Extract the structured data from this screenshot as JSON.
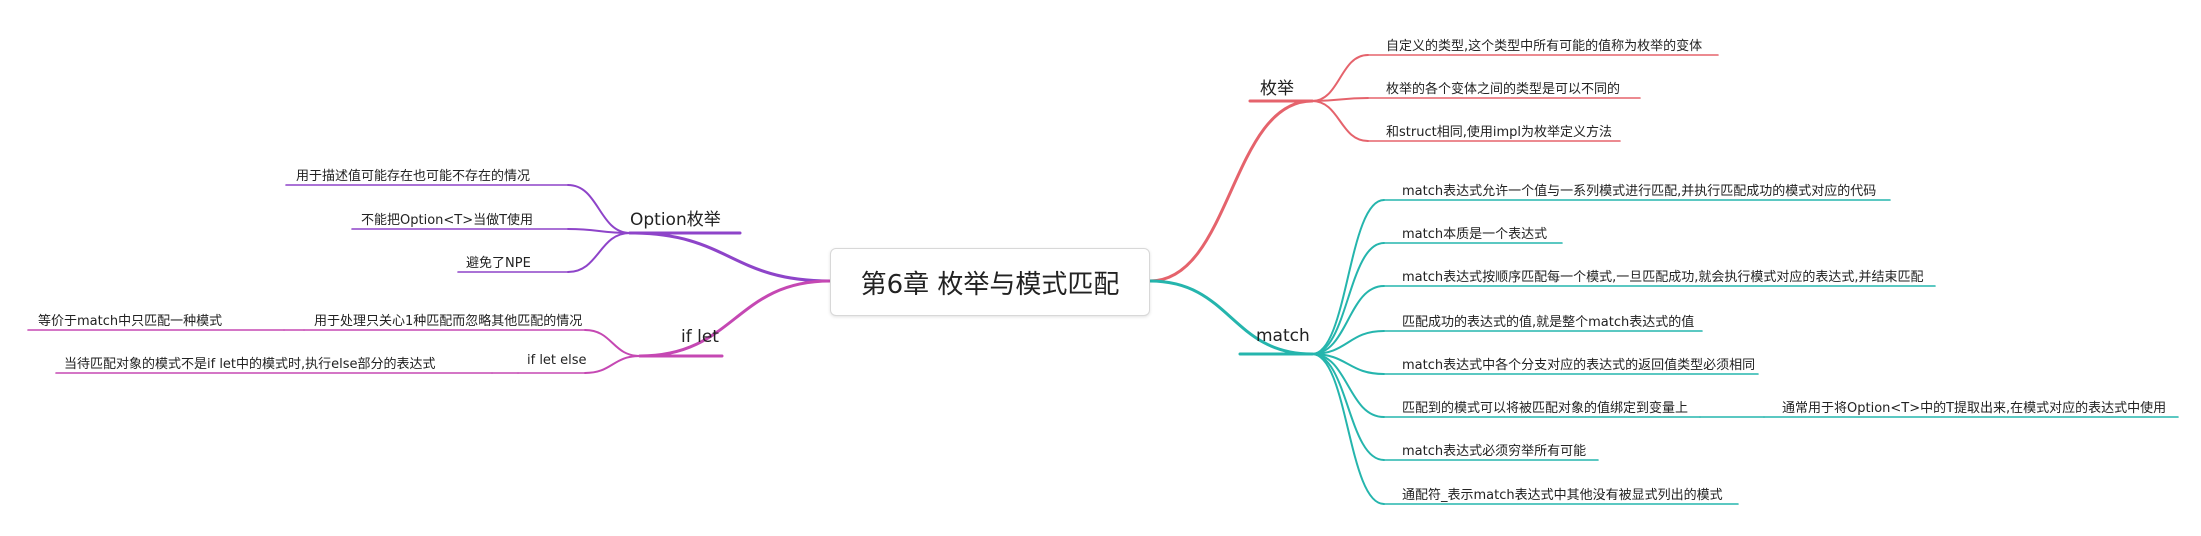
{
  "central": {
    "title": "第6章 枚举与模式匹配"
  },
  "colors": {
    "enum": "#e5636c",
    "match": "#25b5ad",
    "option": "#8e44c9",
    "iflet": "#c548b3"
  },
  "branches": {
    "enum": {
      "label": "枚举",
      "items": [
        "自定义的类型,这个类型中所有可能的值称为枚举的变体",
        "枚举的各个变体之间的类型是可以不同的",
        "和struct相同,使用impl为枚举定义方法"
      ]
    },
    "match": {
      "label": "match",
      "items": [
        "match表达式允许一个值与一系列模式进行匹配,并执行匹配成功的模式对应的代码",
        "match本质是一个表达式",
        "match表达式按顺序匹配每一个模式,一旦匹配成功,就会执行模式对应的表达式,并结束匹配",
        "匹配成功的表达式的值,就是整个match表达式的值",
        "match表达式中各个分支对应的表达式的返回值类型必须相同",
        "匹配到的模式可以将被匹配对象的值绑定到变量上",
        "match表达式必须穷举所有可能",
        "通配符_表示match表达式中其他没有被显式列出的模式"
      ],
      "sub": "通常用于将Option<T>中的T提取出来,在模式对应的表达式中使用"
    },
    "option": {
      "label": "Option枚举",
      "items": [
        "用于描述值可能存在也可能不存在的情况",
        "不能把Option<T>当做T使用",
        "避免了NPE"
      ]
    },
    "iflet": {
      "label": "if let",
      "items": [
        "用于处理只关心1种匹配而忽略其他匹配的情况",
        "if let else"
      ],
      "sub1": "等价于match中只匹配一种模式",
      "sub2": "当待匹配对象的模式不是if let中的模式时,执行else部分的表达式"
    }
  }
}
